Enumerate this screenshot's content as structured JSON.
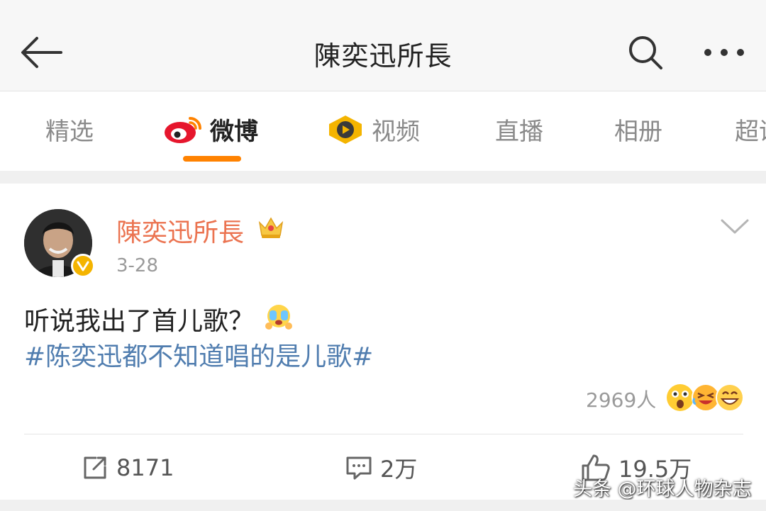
{
  "header": {
    "title": "陳奕迅所長",
    "back_icon": "arrow-left-icon",
    "search_icon": "search-icon",
    "more_icon": "more-dots-icon"
  },
  "tabs": [
    {
      "label": "精选",
      "active": false
    },
    {
      "label": "微博",
      "active": true,
      "icon": "weibo-logo-icon"
    },
    {
      "label": "视频",
      "active": false,
      "icon": "video-play-icon"
    },
    {
      "label": "直播",
      "active": false
    },
    {
      "label": "相册",
      "active": false
    },
    {
      "label": "超话",
      "active": false
    }
  ],
  "post": {
    "username": "陳奕迅所長",
    "username_color": "#eb7350",
    "verified": true,
    "timestamp": "3-28",
    "text": "听说我出了首儿歌？",
    "hashtag": "#陈奕迅都不知道唱的是儿歌#",
    "hashtag_color": "#507daf",
    "reactions_count": "2969人",
    "reaction_icons": [
      "surprised-emoji-icon",
      "laughing-tears-emoji-icon",
      "grinning-emoji-icon"
    ]
  },
  "actions": {
    "repost": {
      "count": "8171",
      "icon": "share-icon"
    },
    "comment": {
      "count": "2万",
      "icon": "comment-icon"
    },
    "like": {
      "count": "19.5万",
      "icon": "thumbs-up-icon"
    }
  },
  "watermark": "头条 @环球人物杂志",
  "colors": {
    "accent": "#ff8200",
    "background": "#f2f2f2"
  }
}
